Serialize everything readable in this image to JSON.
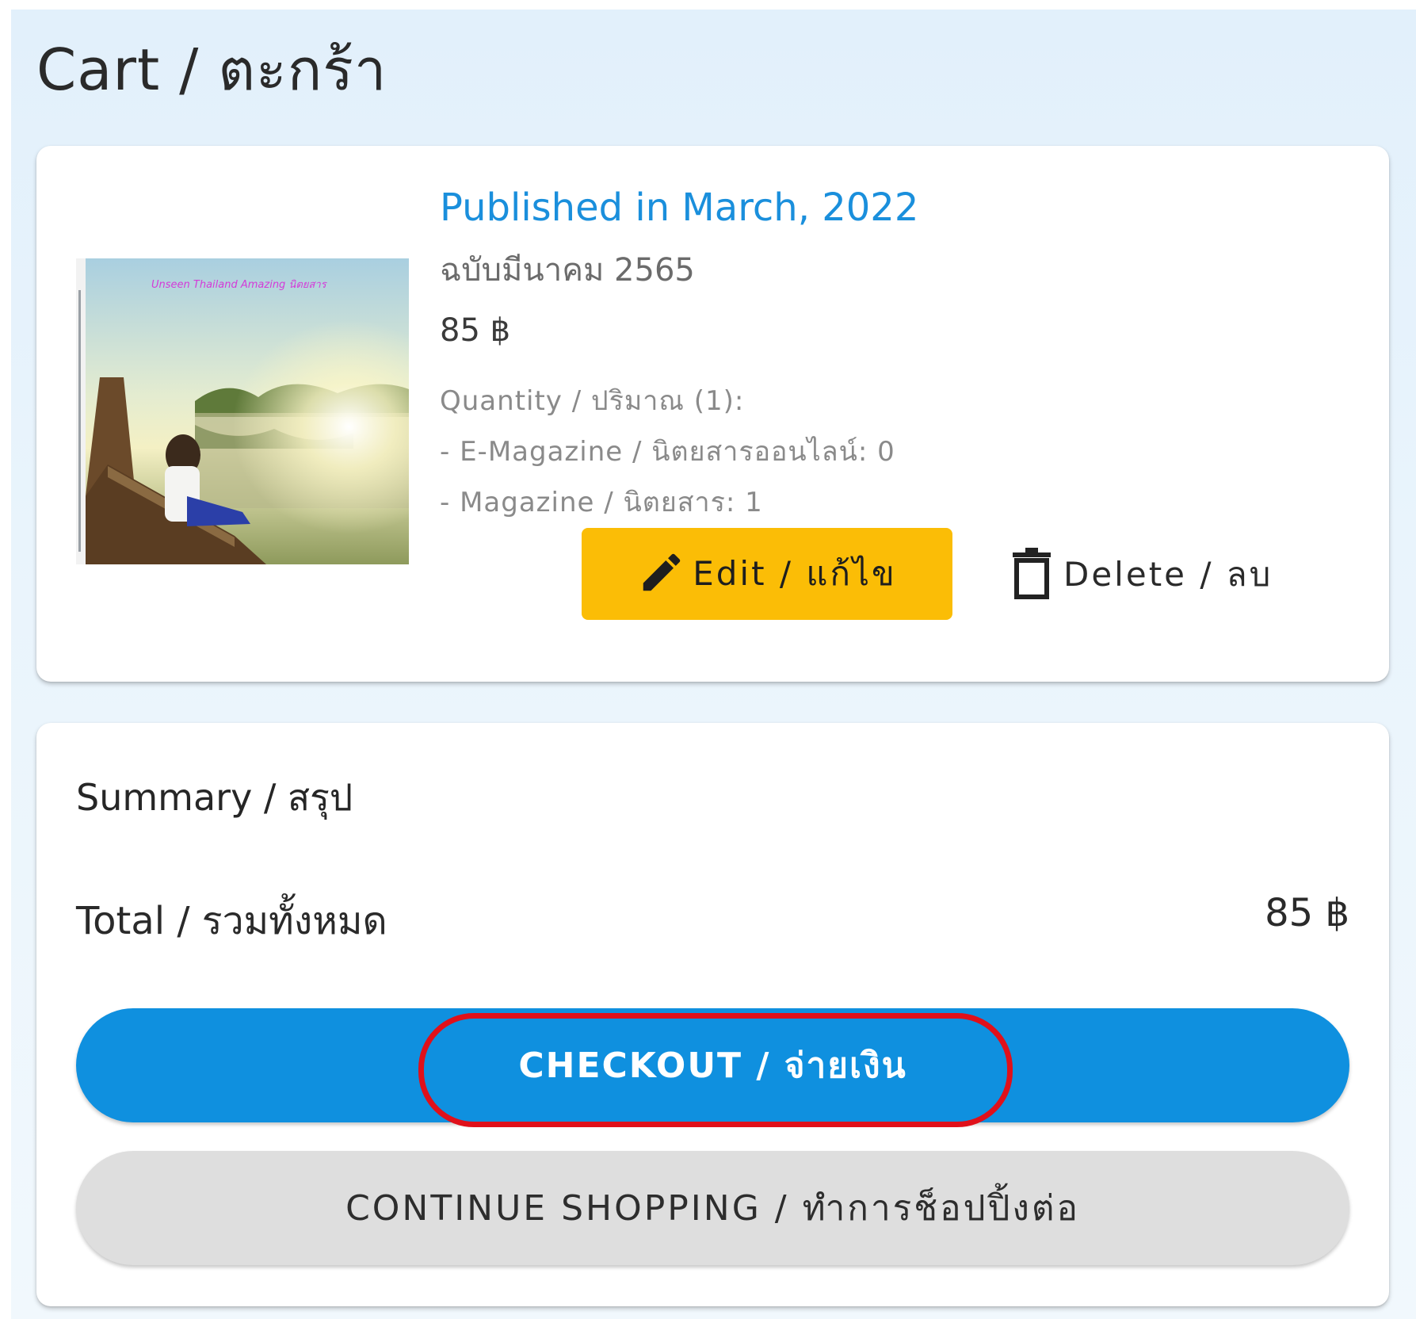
{
  "page": {
    "title": "Cart / ตะกร้า"
  },
  "cart": {
    "item": {
      "cover_text": "Unseen Thailand Amazing นิตยสาร",
      "title": "Published in March, 2022",
      "subtitle": "ฉบับมีนาคม 2565",
      "price": "85 ฿",
      "quantity_heading": "Quantity / ปริมาณ (1):",
      "quantity_emagazine": "- E-Magazine / นิตยสารออนไลน์: 0",
      "quantity_magazine": "- Magazine / นิตยสาร: 1",
      "edit_label": "Edit / แก้ไข",
      "delete_label": "Delete / ลบ"
    }
  },
  "summary": {
    "title": "Summary / สรุป",
    "total_label": "Total / รวมทั้งหมด",
    "total_value": "85 ฿",
    "checkout_label": "CHECKOUT / จ่ายเงิน",
    "continue_label": "CONTINUE SHOPPING / ทำการช็อปปิ้งต่อ"
  },
  "colors": {
    "accent": "#0f90df",
    "title_link": "#1a8fdc",
    "edit_button": "#fbbd06",
    "highlight": "#e0101a"
  },
  "icons": {
    "edit": "pencil-icon",
    "delete": "trash-icon"
  }
}
